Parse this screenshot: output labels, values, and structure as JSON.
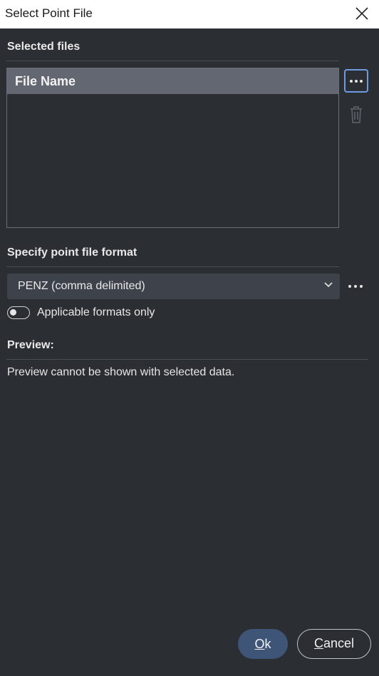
{
  "window": {
    "title": "Select Point File",
    "close_icon": "close-icon"
  },
  "selected_files": {
    "label": "Selected files",
    "column_header": "File Name",
    "rows": [],
    "browse_icon": "ellipsis-icon",
    "delete_icon": "trash-icon"
  },
  "format": {
    "label": "Specify point file format",
    "selected": "PENZ (comma delimited)",
    "dropdown_icon": "chevron-down-icon",
    "more_icon": "ellipsis-icon",
    "toggle_label": "Applicable formats only",
    "toggle_on": false
  },
  "preview": {
    "label": "Preview:",
    "message": "Preview cannot be shown with selected data."
  },
  "buttons": {
    "ok_mnemonic": "O",
    "ok_rest": "k",
    "cancel_mnemonic": "C",
    "cancel_rest": "ancel"
  },
  "colors": {
    "background": "#2b2e33",
    "accent": "#6f9ce0",
    "primary_button": "#3f5578",
    "header": "#636772"
  }
}
